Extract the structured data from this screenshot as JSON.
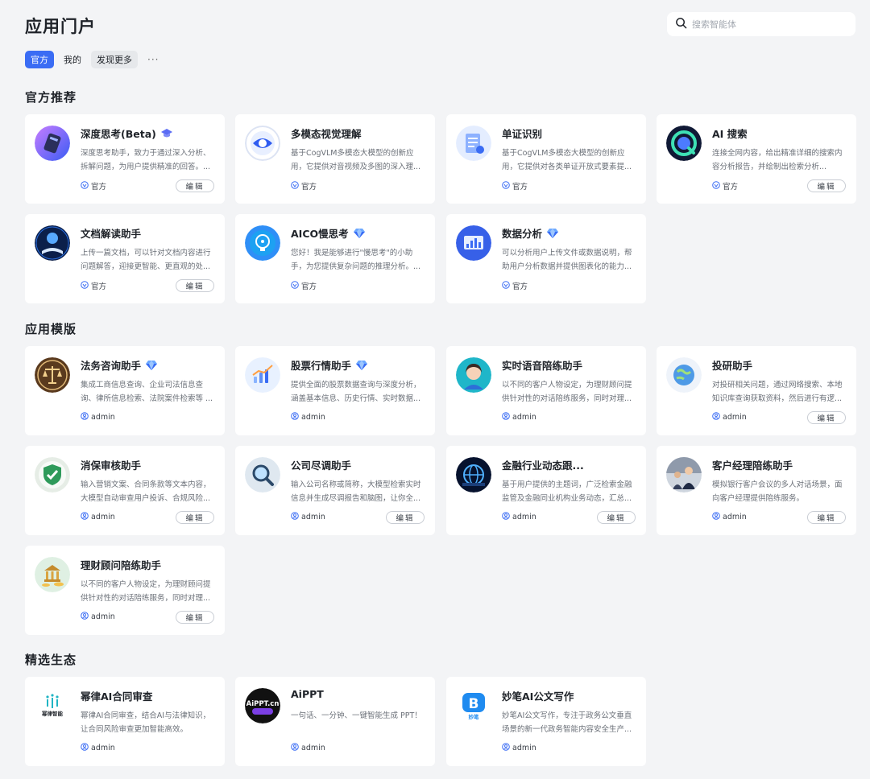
{
  "page_title": "应用门户",
  "search": {
    "placeholder": "搜索智能体"
  },
  "tabs": [
    {
      "label": "官方",
      "active": true
    },
    {
      "label": "我的",
      "active": false
    },
    {
      "label": "发现更多",
      "active": false
    },
    {
      "label": "···",
      "active": false
    }
  ],
  "colors": {
    "accent": "#3a6cf4",
    "background": "#f3f4f6",
    "card": "#ffffff"
  },
  "edit_label": "编辑",
  "sections": [
    {
      "title": "官方推荐",
      "cards": [
        {
          "title": "深度思考(Beta)",
          "badge": "graduation-cap-icon",
          "desc": "深度思考助手，致力于通过深入分析、拆解问题，为用户提供精准的回答。...",
          "owner": "官方",
          "owner_icon": "verified-icon",
          "edit": true,
          "icon": "deep-thinking-icon"
        },
        {
          "title": "多模态视觉理解",
          "badge": null,
          "desc": "基于CogVLM多模态大模型的创新应用，它提供对音视频及多图的深入理...",
          "owner": "官方",
          "owner_icon": "verified-icon",
          "edit": false,
          "icon": "multimodal-vision-icon"
        },
        {
          "title": "单证识别",
          "badge": null,
          "desc": "基于CogVLM多模态大模型的创新应用，它提供对各类单证开放式要素提...",
          "owner": "官方",
          "owner_icon": "verified-icon",
          "edit": false,
          "icon": "document-recognition-icon"
        },
        {
          "title": "AI 搜索",
          "badge": null,
          "desc": "连接全网内容，给出精准详细的搜索内容分析报告，并绘制出检索分析...",
          "owner": "官方",
          "owner_icon": "verified-icon",
          "edit": true,
          "icon": "ai-search-icon"
        },
        {
          "title": "文档解读助手",
          "badge": null,
          "desc": "上传一篇文档，可以针对文档内容进行问题解答，迎接更智能、更直观的处...",
          "owner": "官方",
          "owner_icon": "verified-icon",
          "edit": true,
          "icon": "document-reading-icon"
        },
        {
          "title": "AICO慢思考",
          "badge": "diamond-icon",
          "desc": "您好！我是能够进行\"慢思考\"的小助手，为您提供复杂问题的推理分析。...",
          "owner": "官方",
          "owner_icon": "verified-icon",
          "edit": false,
          "icon": "slow-thinking-icon"
        },
        {
          "title": "数据分析",
          "badge": "diamond-icon",
          "desc": "可以分析用户上传文件或数据说明，帮助用户分析数据并提供图表化的能力...",
          "owner": "官方",
          "owner_icon": "verified-icon",
          "edit": false,
          "icon": "data-analysis-icon"
        }
      ]
    },
    {
      "title": "应用模版",
      "cards": [
        {
          "title": "法务咨询助手",
          "badge": "diamond-icon",
          "desc": "集成工商信息查询、企业司法信息查询、律所信息检索、法院案件检索等 ...",
          "owner": "admin",
          "owner_icon": "user-icon",
          "edit": false,
          "icon": "legal-scale-icon"
        },
        {
          "title": "股票行情助手",
          "badge": "diamond-icon",
          "desc": "提供全面的股票数据查询与深度分析，涵盖基本信息、历史行情、实时数据...",
          "owner": "admin",
          "owner_icon": "user-icon",
          "edit": false,
          "icon": "stock-chart-icon"
        },
        {
          "title": "实时语音陪练助手",
          "badge": null,
          "desc": "以不同的客户人物设定，为理财顾问提供针对性的对话陪练服务，同时对理...",
          "owner": "admin",
          "owner_icon": "user-icon",
          "edit": false,
          "icon": "voice-avatar-icon"
        },
        {
          "title": "投研助手",
          "badge": null,
          "desc": "对投研相关问题，通过网络搜索、本地知识库查询获取资料，然后进行有逻...",
          "owner": "admin",
          "owner_icon": "user-icon",
          "edit": true,
          "icon": "research-globe-icon"
        },
        {
          "title": "消保审核助手",
          "badge": null,
          "desc": "输入营销文案、合同条款等文本内容，大模型自动审查用户投诉、合规风险...",
          "owner": "admin",
          "owner_icon": "user-icon",
          "edit": true,
          "icon": "shield-check-icon"
        },
        {
          "title": "公司尽调助手",
          "badge": null,
          "desc": "输入公司名称或简称，大模型检索实时信息并生成尽调报告和脑图，让你全...",
          "owner": "admin",
          "owner_icon": "user-icon",
          "edit": true,
          "icon": "magnifier-icon"
        },
        {
          "title": "金融行业动态跟...",
          "badge": null,
          "desc": "基于用户提供的主题词，广泛检索金融监管及金融同业机构业务动态，汇总...",
          "owner": "admin",
          "owner_icon": "user-icon",
          "edit": true,
          "icon": "finance-globe-icon"
        },
        {
          "title": "客户经理陪练助手",
          "badge": null,
          "desc": "模拟银行客户会议的多人对话场景，面向客户经理提供陪练服务。",
          "owner": "admin",
          "owner_icon": "user-icon",
          "edit": true,
          "icon": "meeting-photo-icon"
        },
        {
          "title": "理财顾问陪练助手",
          "badge": null,
          "desc": "以不同的客户人物设定，为理财顾问提供针对性的对话陪练服务，同时对理...",
          "owner": "admin",
          "owner_icon": "user-icon",
          "edit": true,
          "icon": "bank-coins-icon"
        }
      ]
    },
    {
      "title": "精选生态",
      "cards": [
        {
          "title": "幂律AI合同审查",
          "badge": null,
          "desc": "幂律AI合同审查，结合AI与法律知识，让合同风险审查更加智能高效。",
          "owner": "admin",
          "owner_icon": "user-icon",
          "edit": false,
          "icon": "powerlaw-logo-icon",
          "logo_text": "幂律智能"
        },
        {
          "title": "AiPPT",
          "badge": null,
          "desc": "一句话、一分钟、一键智能生成 PPT！",
          "owner": "admin",
          "owner_icon": "user-icon",
          "edit": false,
          "icon": "aippt-logo-icon",
          "logo_text": "AiPPT.cn"
        },
        {
          "title": "妙笔AI公文写作",
          "badge": null,
          "desc": "妙笔AI公文写作，专注于政务公文垂直场景的新一代政务智能内容安全生产...",
          "owner": "admin",
          "owner_icon": "user-icon",
          "edit": false,
          "icon": "miaobi-logo-icon",
          "logo_text": "妙笔"
        }
      ]
    }
  ]
}
